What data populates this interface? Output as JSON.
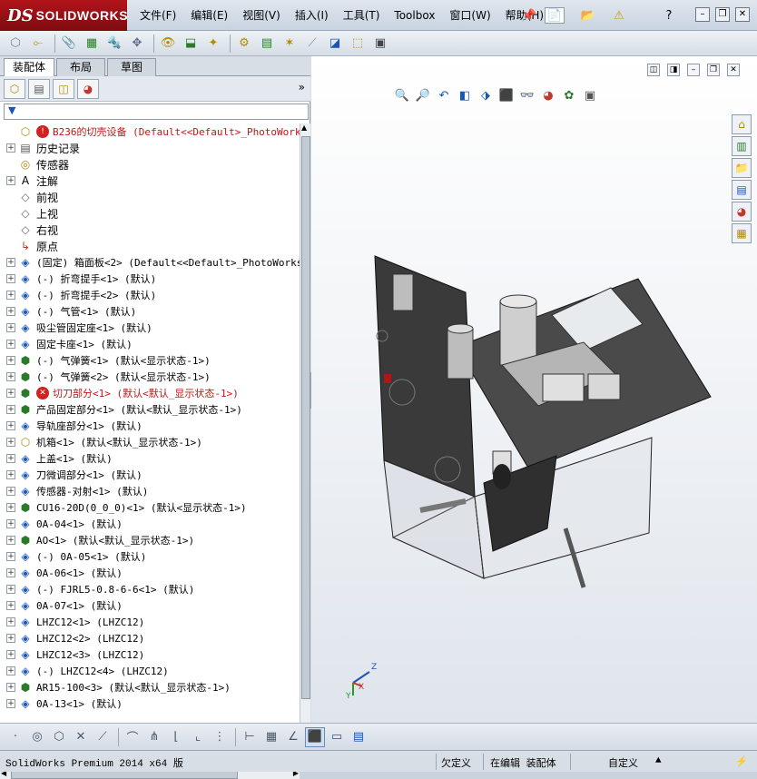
{
  "app": {
    "logo_ds": "DS",
    "logo_text": "SOLIDWORKS"
  },
  "menu": [
    "文件(F)",
    "编辑(E)",
    "视图(V)",
    "插入(I)",
    "工具(T)",
    "Toolbox",
    "窗口(W)",
    "帮助(H)"
  ],
  "panel_tabs": [
    "装配体",
    "布局",
    "草图"
  ],
  "filter_icon": "filter-icon",
  "tree": [
    {
      "label": "B236的切壳设备  (Default<<Default>_PhotoWorks 显",
      "icon": "assembly-icon",
      "exp": false,
      "status": "error",
      "root": true
    },
    {
      "label": "历史记录",
      "icon": "history-icon",
      "exp": true
    },
    {
      "label": "传感器",
      "icon": "sensor-icon",
      "exp": false
    },
    {
      "label": "注解",
      "icon": "annotation-icon",
      "exp": true
    },
    {
      "label": "前视",
      "icon": "plane-icon",
      "exp": false
    },
    {
      "label": "上视",
      "icon": "plane-icon",
      "exp": false
    },
    {
      "label": "右视",
      "icon": "plane-icon",
      "exp": false
    },
    {
      "label": "原点",
      "icon": "origin-icon",
      "exp": false
    },
    {
      "label": "(固定) 箱面板<2> (Default<<Default>_PhotoWorks ...",
      "icon": "part-icon",
      "exp": true
    },
    {
      "label": "(-) 折弯提手<1> (默认)",
      "icon": "part-icon",
      "exp": true
    },
    {
      "label": "(-) 折弯提手<2> (默认)",
      "icon": "part-icon",
      "exp": true
    },
    {
      "label": "(-) 气管<1> (默认)",
      "icon": "part-icon",
      "exp": true
    },
    {
      "label": "吸尘管固定座<1> (默认)",
      "icon": "part-icon",
      "exp": true
    },
    {
      "label": "固定卡座<1> (默认)",
      "icon": "part-icon",
      "exp": true
    },
    {
      "label": "(-) 气弹簧<1> (默认<显示状态-1>)",
      "icon": "subassembly-icon",
      "exp": true
    },
    {
      "label": "(-) 气弹簧<2> (默认<显示状态-1>)",
      "icon": "subassembly-icon",
      "exp": true
    },
    {
      "label": "切刀部分<1> (默认<默认_显示状态-1>)",
      "icon": "subassembly-icon",
      "exp": true,
      "status": "error"
    },
    {
      "label": "产品固定部分<1> (默认<默认_显示状态-1>)",
      "icon": "subassembly-icon",
      "exp": true
    },
    {
      "label": "导轨座部分<1> (默认)",
      "icon": "part-icon",
      "exp": true
    },
    {
      "label": "机箱<1> (默认<默认_显示状态-1>)",
      "icon": "assembly-icon",
      "exp": true
    },
    {
      "label": "上盖<1> (默认)",
      "icon": "part-icon",
      "exp": true
    },
    {
      "label": "刀微调部分<1> (默认)",
      "icon": "part-icon",
      "exp": true
    },
    {
      "label": "传感器-对射<1> (默认)",
      "icon": "part-icon",
      "exp": true
    },
    {
      "label": "CU16-20D(0_0_0)<1> (默认<显示状态-1>)",
      "icon": "subassembly-icon",
      "exp": true
    },
    {
      "label": "0A-04<1> (默认)",
      "icon": "part-icon",
      "exp": true
    },
    {
      "label": "AO<1> (默认<默认_显示状态-1>)",
      "icon": "subassembly-icon",
      "exp": true
    },
    {
      "label": "(-) 0A-05<1> (默认)",
      "icon": "part-icon",
      "exp": true
    },
    {
      "label": "0A-06<1> (默认)",
      "icon": "part-icon",
      "exp": true
    },
    {
      "label": "(-) FJRL5-0.8-6-6<1> (默认)",
      "icon": "part-icon",
      "exp": true
    },
    {
      "label": "0A-07<1> (默认)",
      "icon": "part-icon",
      "exp": true
    },
    {
      "label": "LHZC12<1> (LHZC12)",
      "icon": "part-icon",
      "exp": true
    },
    {
      "label": "LHZC12<2> (LHZC12)",
      "icon": "part-icon",
      "exp": true
    },
    {
      "label": "LHZC12<3> (LHZC12)",
      "icon": "part-icon",
      "exp": true
    },
    {
      "label": "(-) LHZC12<4> (LHZC12)",
      "icon": "part-icon",
      "exp": true
    },
    {
      "label": "AR15-100<3> (默认<默认_显示状态-1>)",
      "icon": "subassembly-icon",
      "exp": true
    },
    {
      "label": "0A-13<1> (默认)",
      "icon": "part-icon",
      "exp": true
    }
  ],
  "triad": {
    "x": "X",
    "y": "Y",
    "z": "Z"
  },
  "status": {
    "app_name": "SolidWorks Premium 2014 x64 版",
    "under_defined": "欠定义",
    "editing": "在编辑 装配体",
    "custom": "自定义"
  }
}
